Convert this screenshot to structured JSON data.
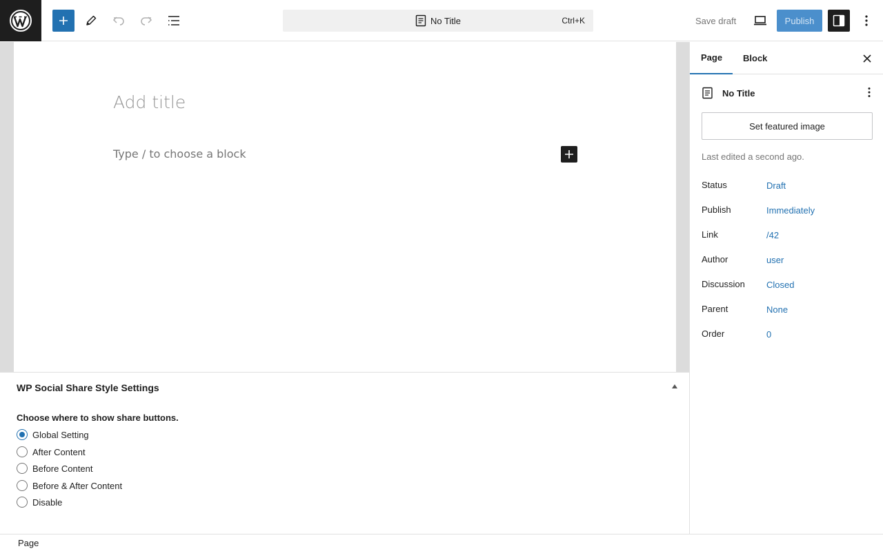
{
  "topbar": {
    "icons": {
      "logo": "wordpress-logo-icon",
      "add": "plus-icon",
      "tools": "pencil-icon",
      "undo": "undo-icon",
      "redo": "redo-icon",
      "outline": "list-view-icon",
      "preview": "laptop-icon",
      "settings": "sidebar-panel-icon",
      "options": "more-vertical-icon"
    },
    "document_title": "No Title",
    "shortcut": "Ctrl+K",
    "save_draft": "Save draft",
    "publish": "Publish"
  },
  "canvas": {
    "title_placeholder": "Add title",
    "block_placeholder": "Type / to choose a block"
  },
  "metabox": {
    "title": "WP Social Share Style Settings",
    "label": "Choose where to show share buttons.",
    "options": [
      {
        "label": "Global Setting",
        "checked": true
      },
      {
        "label": "After Content",
        "checked": false
      },
      {
        "label": "Before Content",
        "checked": false
      },
      {
        "label": "Before & After Content",
        "checked": false
      },
      {
        "label": "Disable",
        "checked": false
      }
    ]
  },
  "sidebar": {
    "tabs": [
      {
        "label": "Page",
        "active": true
      },
      {
        "label": "Block",
        "active": false
      }
    ],
    "doc_title": "No Title",
    "featured_image_button": "Set featured image",
    "last_edited": "Last edited a second ago.",
    "rows": [
      {
        "key": "Status",
        "value": "Draft"
      },
      {
        "key": "Publish",
        "value": "Immediately"
      },
      {
        "key": "Link",
        "value": "/42"
      },
      {
        "key": "Author",
        "value": "user"
      },
      {
        "key": "Discussion",
        "value": "Closed"
      },
      {
        "key": "Parent",
        "value": "None"
      },
      {
        "key": "Order",
        "value": "0"
      }
    ]
  },
  "footer": {
    "breadcrumb": "Page"
  },
  "colors": {
    "accent": "#2271b1",
    "dark": "#1e1e1e",
    "muted": "#757575"
  }
}
